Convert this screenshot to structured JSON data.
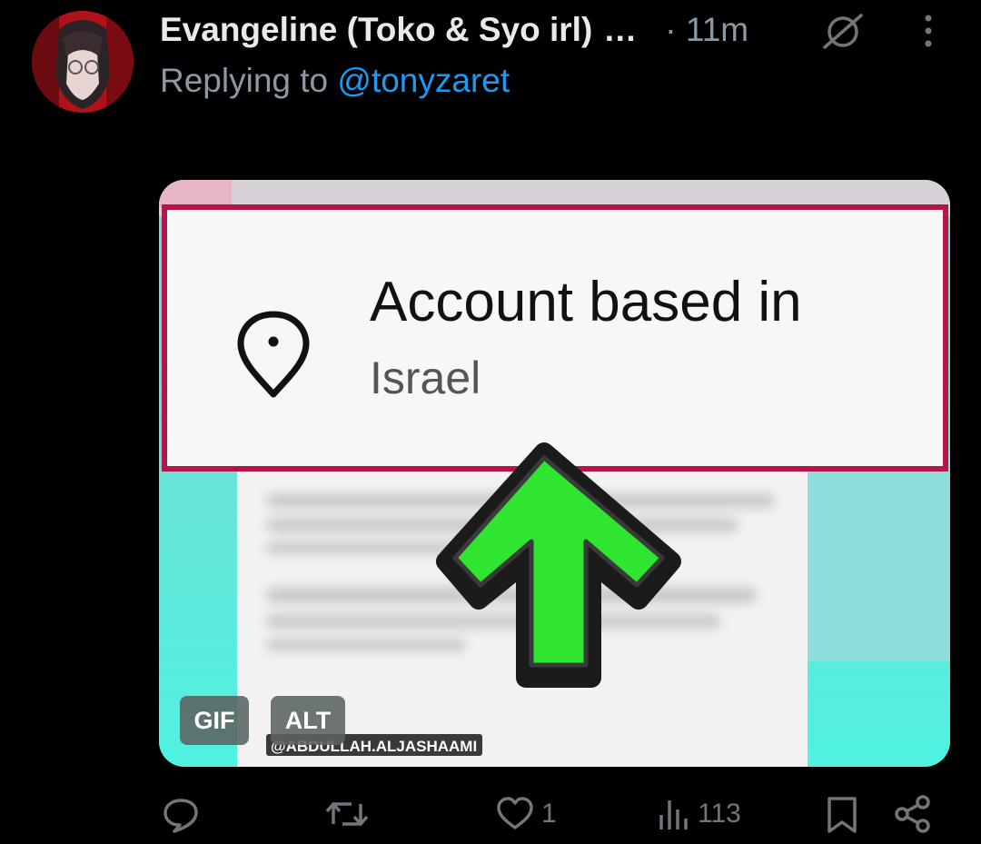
{
  "tweet": {
    "display_name": "Evangeline (Toko & Syo irl)",
    "name_ellipsis": "…",
    "time": "· 11m",
    "replying_to_prefix": "Replying to",
    "replying_to_handle": "@tonyzaret"
  },
  "media": {
    "headline": "Account based in",
    "location": "Israel",
    "watermark": "@ABDULLAH.ALJASHAAMI",
    "badges": {
      "gif": "GIF",
      "alt": "ALT"
    }
  },
  "actions": {
    "replies": "",
    "retweets": "",
    "likes": "1",
    "views": "113"
  },
  "colors": {
    "background": "#000000",
    "text_primary": "#e7e9ea",
    "text_secondary": "#8b98a5",
    "link": "#1d9bf0",
    "frame_border": "#b5164a",
    "arrow_green": "#2fe52f"
  },
  "icons": [
    "no-entry-icon",
    "more-icon",
    "location-pin-icon",
    "up-arrow-icon",
    "reply-icon",
    "retweet-icon",
    "like-icon",
    "views-icon",
    "bookmark-icon",
    "share-icon"
  ]
}
